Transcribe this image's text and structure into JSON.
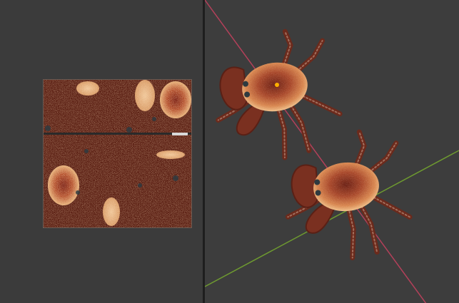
{
  "app": {
    "uv_editor": {
      "image": "crab-texture-atlas"
    },
    "viewport": {
      "object": "crab-model",
      "instances": 2,
      "axes": {
        "x_axis_color": "#b4405a",
        "y_axis_color": "#6e9a30"
      }
    }
  },
  "colors": {
    "background_uv": "#3b3b3b",
    "background_viewport": "#3d3d3d",
    "shell_dark": "#6b1f14",
    "shell_mid": "#a8472a",
    "shell_light": "#e8b27a",
    "origin_dot": "#ffb000"
  }
}
